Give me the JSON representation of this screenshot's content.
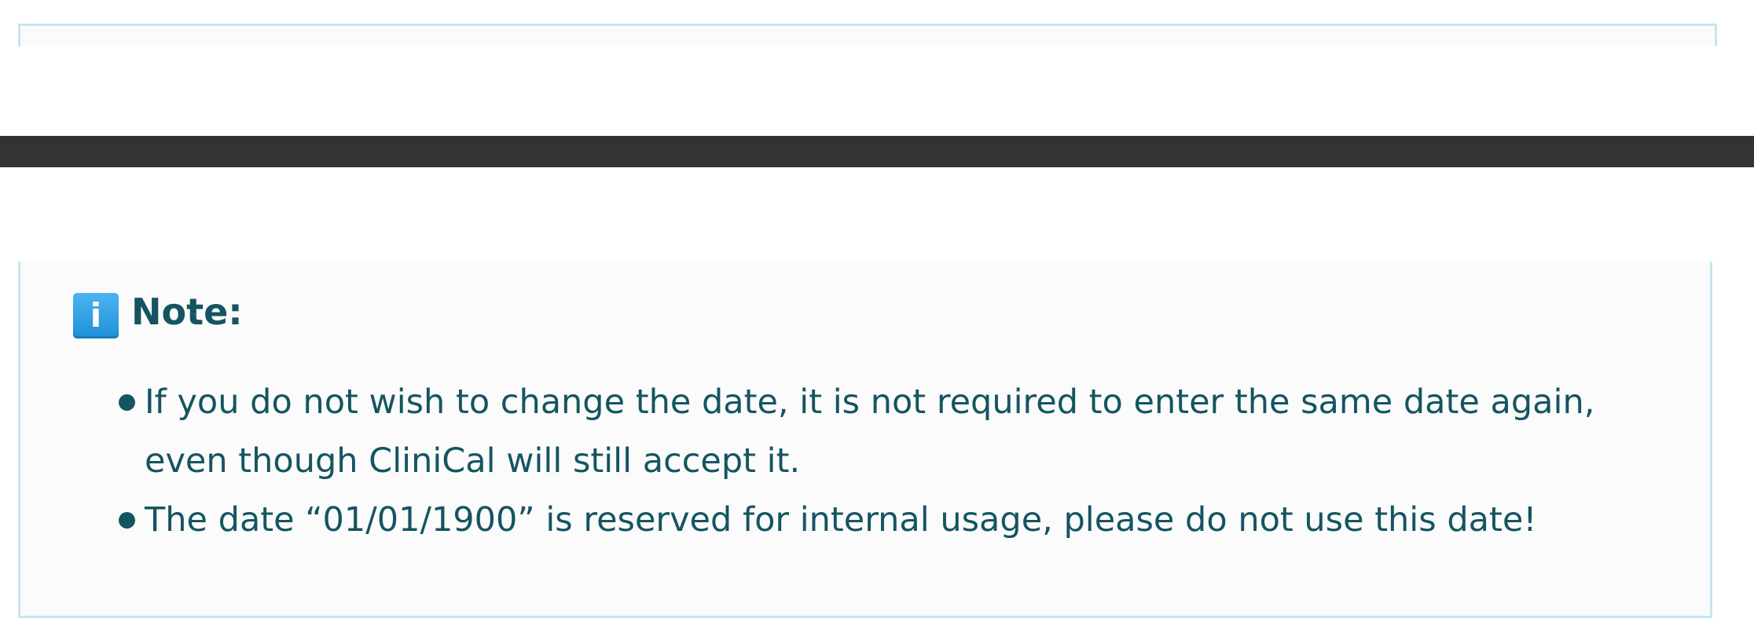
{
  "note": {
    "icon": "info-icon",
    "icon_glyph": "i",
    "title": "Note:",
    "items": [
      "If you do not wish to change the date, it is not required to enter the same date again, even though CliniCal will still accept it.",
      "The date “01/01/1900” is reserved for internal usage, please do not use this date!"
    ]
  },
  "colors": {
    "text": "#145561",
    "border": "#c6e6ee",
    "box_background": "#fbfbfb",
    "dark_bar": "#333333",
    "icon_blue": "#1e8fd8"
  }
}
